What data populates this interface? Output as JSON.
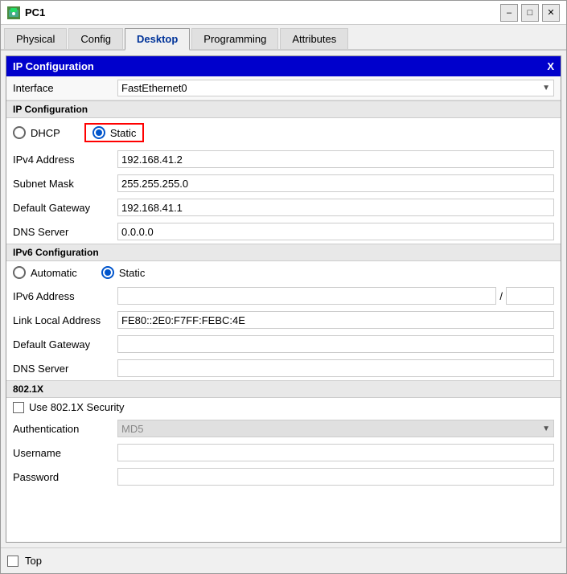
{
  "window": {
    "title": "PC1",
    "icon": "pc-icon"
  },
  "title_bar_buttons": {
    "minimize": "–",
    "maximize": "□",
    "close": "✕"
  },
  "tabs": [
    {
      "label": "Physical",
      "active": false
    },
    {
      "label": "Config",
      "active": false
    },
    {
      "label": "Desktop",
      "active": true
    },
    {
      "label": "Programming",
      "active": false
    },
    {
      "label": "Attributes",
      "active": false
    }
  ],
  "panel": {
    "title": "IP Configuration",
    "close_btn": "X"
  },
  "interface": {
    "label": "Interface",
    "value": "FastEthernet0"
  },
  "ip_config": {
    "section_label": "IP Configuration",
    "dhcp_label": "DHCP",
    "static_label": "Static",
    "static_selected": true,
    "dhcp_selected": false,
    "fields": [
      {
        "label": "IPv4 Address",
        "value": "192.168.41.2"
      },
      {
        "label": "Subnet Mask",
        "value": "255.255.255.0"
      },
      {
        "label": "Default Gateway",
        "value": "192.168.41.1"
      },
      {
        "label": "DNS Server",
        "value": "0.0.0.0"
      }
    ]
  },
  "ipv6_config": {
    "section_label": "IPv6 Configuration",
    "automatic_label": "Automatic",
    "static_label": "Static",
    "static_selected": true,
    "automatic_selected": false,
    "fields": [
      {
        "label": "IPv6 Address",
        "value": "",
        "slash_value": ""
      },
      {
        "label": "Link Local Address",
        "value": "FE80::2E0:F7FF:FEBC:4E"
      },
      {
        "label": "Default Gateway",
        "value": ""
      },
      {
        "label": "DNS Server",
        "value": ""
      }
    ]
  },
  "dot1x": {
    "section_label": "802.1X",
    "checkbox_label": "Use 802.1X Security",
    "auth_label": "Authentication",
    "auth_value": "MD5",
    "username_label": "Username",
    "username_value": "",
    "password_label": "Password",
    "password_value": ""
  },
  "bottom": {
    "checkbox_label": "Top"
  }
}
